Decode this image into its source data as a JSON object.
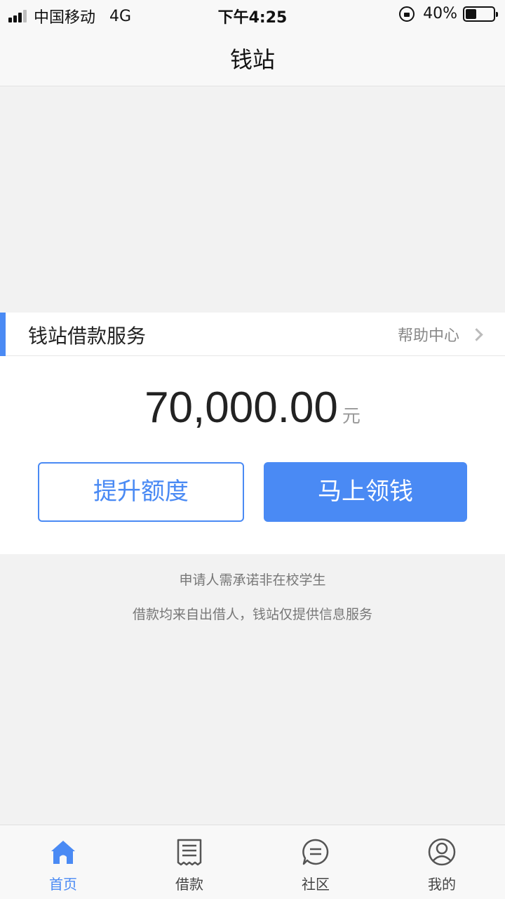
{
  "status_bar": {
    "carrier": "中国移动",
    "network": "4G",
    "time": "下午4:25",
    "battery_percent": "40%",
    "battery_level": 0.4
  },
  "nav": {
    "title": "钱站"
  },
  "section": {
    "title": "钱站借款服务",
    "help_label": "帮助中心"
  },
  "loan": {
    "amount": "70,000.00",
    "unit": "元",
    "raise_limit_label": "提升额度",
    "get_money_label": "马上领钱"
  },
  "notices": [
    "申请人需承诺非在校学生",
    "借款均来自出借人，钱站仅提供信息服务"
  ],
  "tabs": [
    {
      "label": "首页",
      "icon": "home-icon",
      "active": true
    },
    {
      "label": "借款",
      "icon": "receipt-icon",
      "active": false
    },
    {
      "label": "社区",
      "icon": "chat-icon",
      "active": false
    },
    {
      "label": "我的",
      "icon": "user-icon",
      "active": false
    }
  ],
  "colors": {
    "accent": "#4a8af4",
    "background": "#f2f2f2",
    "tab_inactive": "#444444"
  }
}
